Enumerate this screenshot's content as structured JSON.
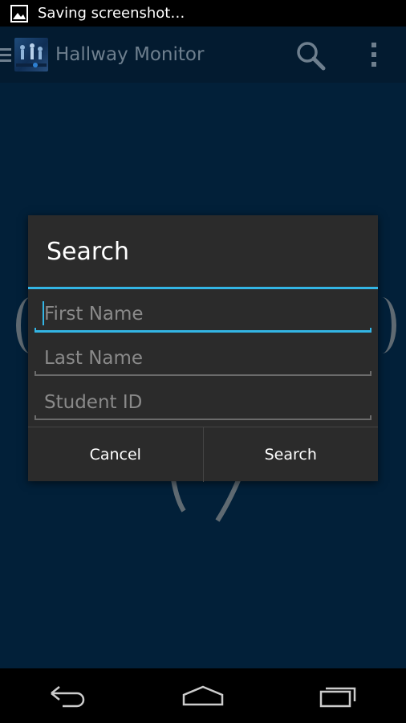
{
  "status_bar": {
    "notification_icon": "image-icon",
    "text": "Saving screenshot…"
  },
  "action_bar": {
    "title": "Hallway Monitor",
    "icons": [
      "drawer-icon",
      "search-icon",
      "overflow-menu-icon"
    ],
    "title_color": "#6e7f8e"
  },
  "dialog": {
    "title": "Search",
    "fields": [
      {
        "placeholder": "First Name",
        "value": ""
      },
      {
        "placeholder": "Last Name",
        "value": ""
      },
      {
        "placeholder": "Student ID",
        "value": ""
      }
    ],
    "buttons": {
      "cancel": "Cancel",
      "search": "Search"
    },
    "accent_color": "#33b5e5"
  },
  "nav_bar": {
    "icons": [
      "back-icon",
      "home-icon",
      "recent-apps-icon"
    ]
  }
}
